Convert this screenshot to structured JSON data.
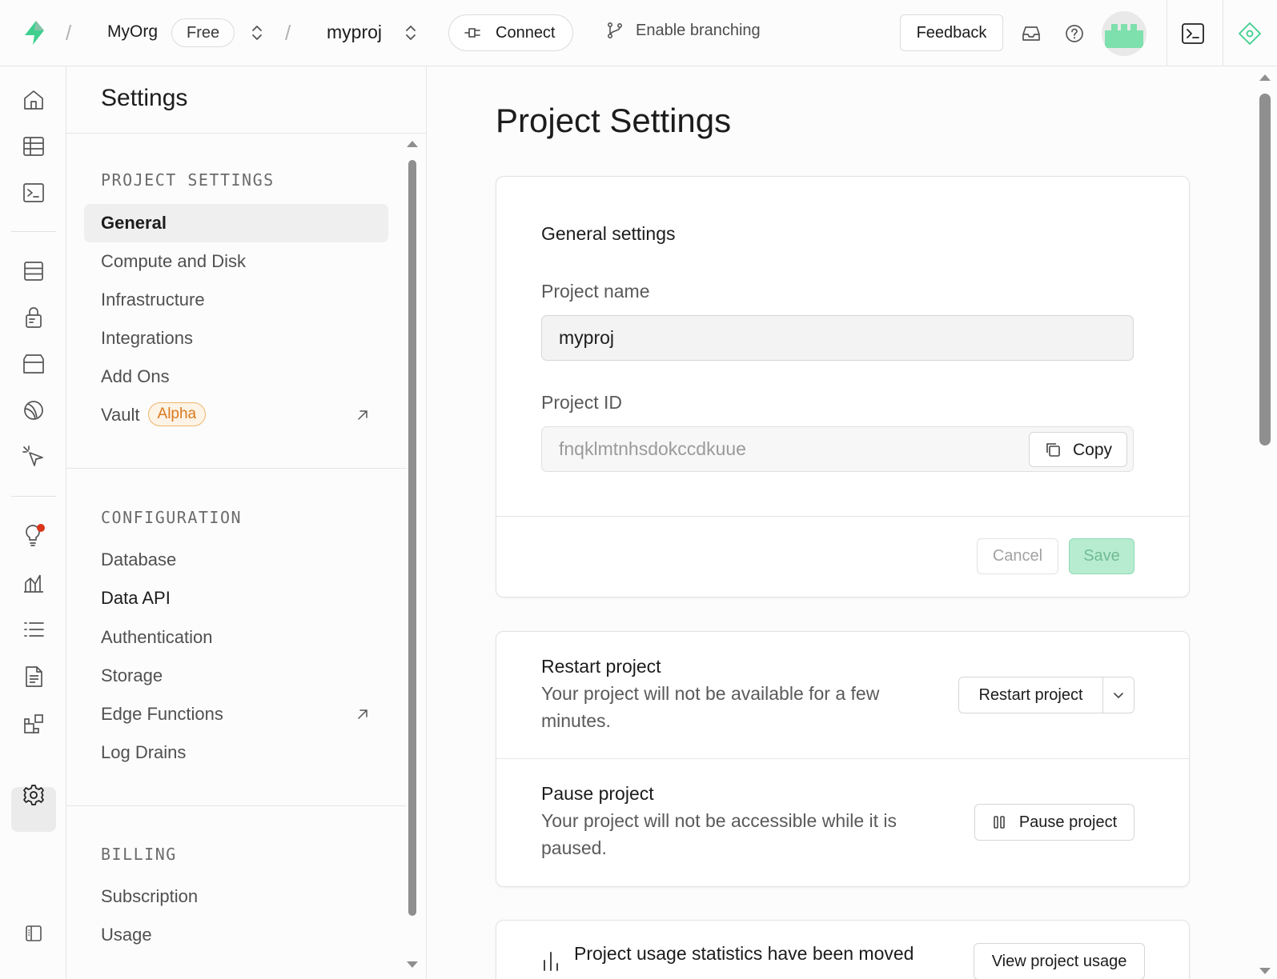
{
  "topbar": {
    "org_name": "MyOrg",
    "plan_badge": "Free",
    "project_name": "myproj",
    "connect_label": "Connect",
    "branching_label": "Enable branching",
    "feedback_label": "Feedback"
  },
  "rail": {
    "icons": [
      "home-icon",
      "table-editor-icon",
      "sql-editor-icon",
      "database-icon",
      "auth-icon",
      "storage-icon",
      "realtime-icon",
      "edge-functions-icon",
      "advisors-icon",
      "reports-icon",
      "logs-icon",
      "api-docs-icon",
      "integrations-icon",
      "settings-icon",
      "collapse-sidebar-icon"
    ],
    "active": "settings-icon"
  },
  "sidebar": {
    "title": "Settings",
    "sections": [
      {
        "label": "PROJECT SETTINGS",
        "items": [
          {
            "label": "General",
            "active": true
          },
          {
            "label": "Compute and Disk"
          },
          {
            "label": "Infrastructure"
          },
          {
            "label": "Integrations"
          },
          {
            "label": "Add Ons"
          },
          {
            "label": "Vault",
            "badge": "Alpha",
            "external": true
          }
        ]
      },
      {
        "label": "CONFIGURATION",
        "items": [
          {
            "label": "Database"
          },
          {
            "label": "Data API"
          },
          {
            "label": "Authentication"
          },
          {
            "label": "Storage"
          },
          {
            "label": "Edge Functions",
            "external": true
          },
          {
            "label": "Log Drains"
          }
        ]
      },
      {
        "label": "BILLING",
        "items": [
          {
            "label": "Subscription"
          },
          {
            "label": "Usage"
          }
        ]
      }
    ]
  },
  "main": {
    "page_title": "Project Settings",
    "general": {
      "heading": "General settings",
      "project_name_label": "Project name",
      "project_name_value": "myproj",
      "project_id_label": "Project ID",
      "project_id_value": "fnqklmtnhsdokccdkuue",
      "copy_label": "Copy",
      "cancel_label": "Cancel",
      "save_label": "Save"
    },
    "restart": {
      "title": "Restart project",
      "description": "Your project will not be available for a few minutes.",
      "button_label": "Restart project"
    },
    "pause": {
      "title": "Pause project",
      "description": "Your project will not be accessible while it is paused.",
      "button_label": "Pause project"
    },
    "usage": {
      "text": "Project usage statistics have been moved",
      "button_label": "View project usage"
    }
  },
  "colors": {
    "brand_green": "#3ecf8e",
    "save_bg": "#b7ecd0",
    "alpha_orange": "#d9791e",
    "notification_red": "#d9341a"
  }
}
